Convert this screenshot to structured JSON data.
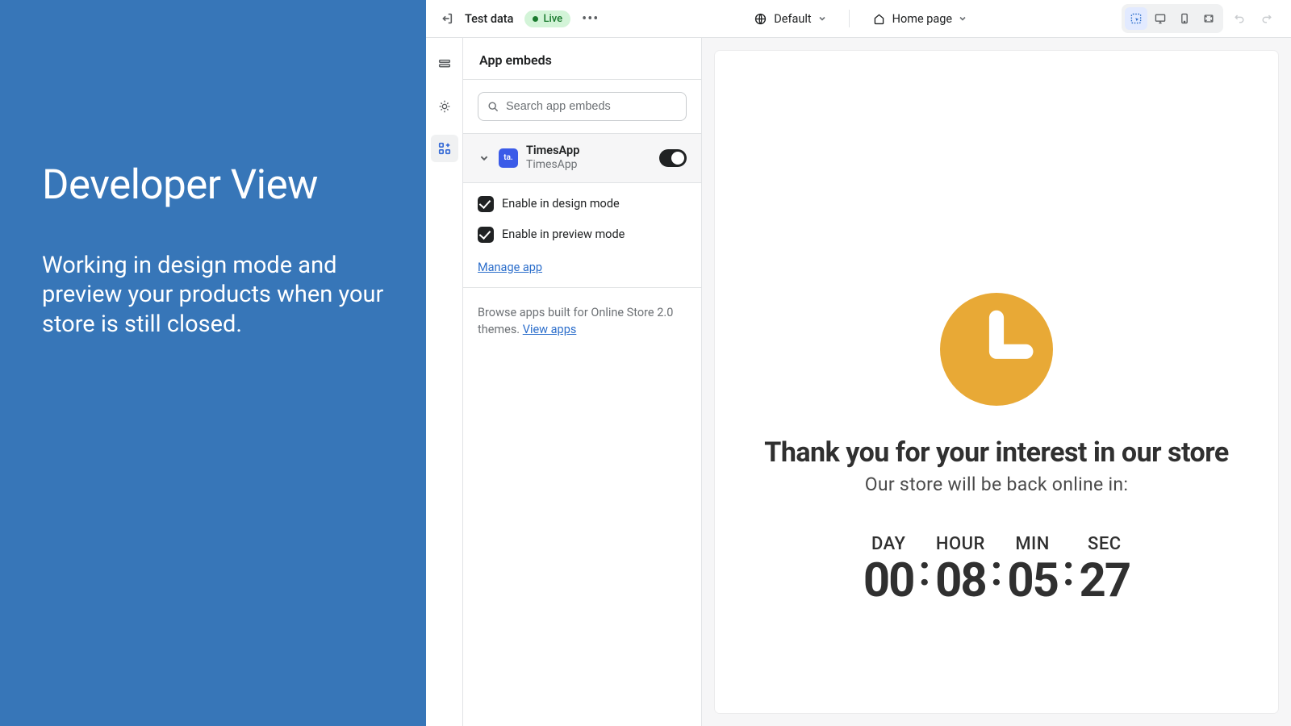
{
  "promo": {
    "title": "Developer View",
    "subtitle": "Working in design mode and preview your products when your store is still closed."
  },
  "topbar": {
    "store_name": "Test data",
    "live_label": "Live",
    "template_label": "Default",
    "page_label": "Home page"
  },
  "sidebar": {
    "title": "App embeds",
    "search_placeholder": "Search app embeds",
    "embed": {
      "name": "TimesApp",
      "sub": "TimesApp",
      "badge_text": "ta.",
      "enabled": true
    },
    "opts": {
      "design_mode": "Enable in design mode",
      "preview_mode": "Enable in preview mode",
      "manage": "Manage app"
    },
    "browse": {
      "text_prefix": "Browse apps built for Online Store 2.0 themes. ",
      "link": "View apps"
    }
  },
  "preview": {
    "heading": "Thank you for your interest in our store",
    "sub": "Our store will be back online in:",
    "countdown": {
      "day_label": "DAY",
      "hour_label": "HOUR",
      "min_label": "MIN",
      "sec_label": "SEC",
      "day": "00",
      "hour": "08",
      "min": "05",
      "sec": "27"
    }
  }
}
